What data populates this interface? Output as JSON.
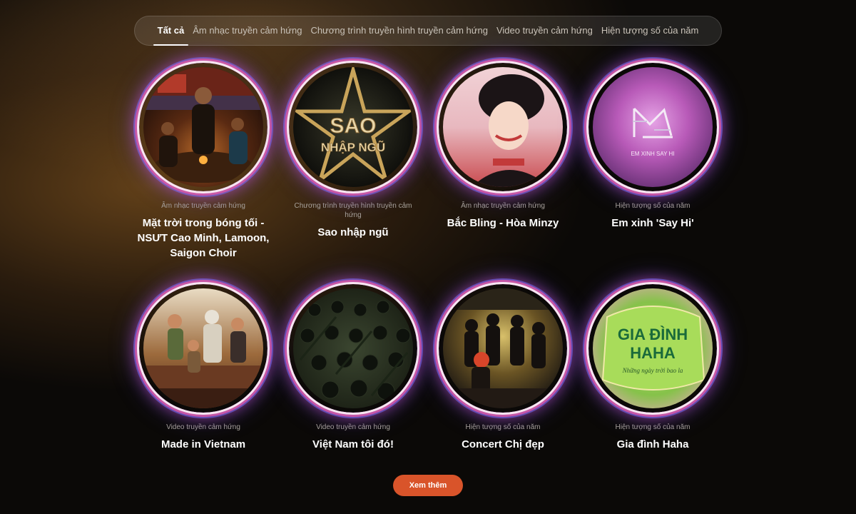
{
  "tabs": [
    {
      "label": "Tất cả",
      "active": true
    },
    {
      "label": "Âm nhạc truyền cảm hứng",
      "active": false
    },
    {
      "label": "Chương trình truyền hình truyền cảm hứng",
      "active": false
    },
    {
      "label": "Video truyền cảm hứng",
      "active": false
    },
    {
      "label": "Hiện tượng số của năm",
      "active": false
    }
  ],
  "cards": [
    {
      "category": "Âm nhạc truyền cảm hứng",
      "title": "Mặt trời trong bóng tối - NSƯT Cao Minh, Lamoon, Saigon Choir"
    },
    {
      "category": "Chương trình truyền hình truyền cảm hứng",
      "title": "Sao nhập ngũ",
      "art_text": [
        "SAO",
        "NHẬP NGŨ"
      ]
    },
    {
      "category": "Âm nhạc truyền cảm hứng",
      "title": "Bắc Bling - Hòa Minzy"
    },
    {
      "category": "Hiện tượng số của năm",
      "title": "Em xinh 'Say Hi'",
      "art_text": [
        "EM XINH SAY HI"
      ]
    },
    {
      "category": "Video truyền cảm hứng",
      "title": "Made in Vietnam"
    },
    {
      "category": "Video truyền cảm hứng",
      "title": "Việt Nam tôi đó!"
    },
    {
      "category": "Hiện tượng số của năm",
      "title": "Concert Chị đẹp"
    },
    {
      "category": "Hiện tượng số của năm",
      "title": "Gia đình Haha",
      "art_text": [
        "GIA ĐÌNH",
        "HAHA",
        "Những ngày trời bao la"
      ]
    }
  ],
  "more_button": {
    "label": "Xem thêm"
  },
  "colors": {
    "accent": "#d9542a",
    "ring_pink": "#e65aa0",
    "ring_blue": "#786eff"
  }
}
